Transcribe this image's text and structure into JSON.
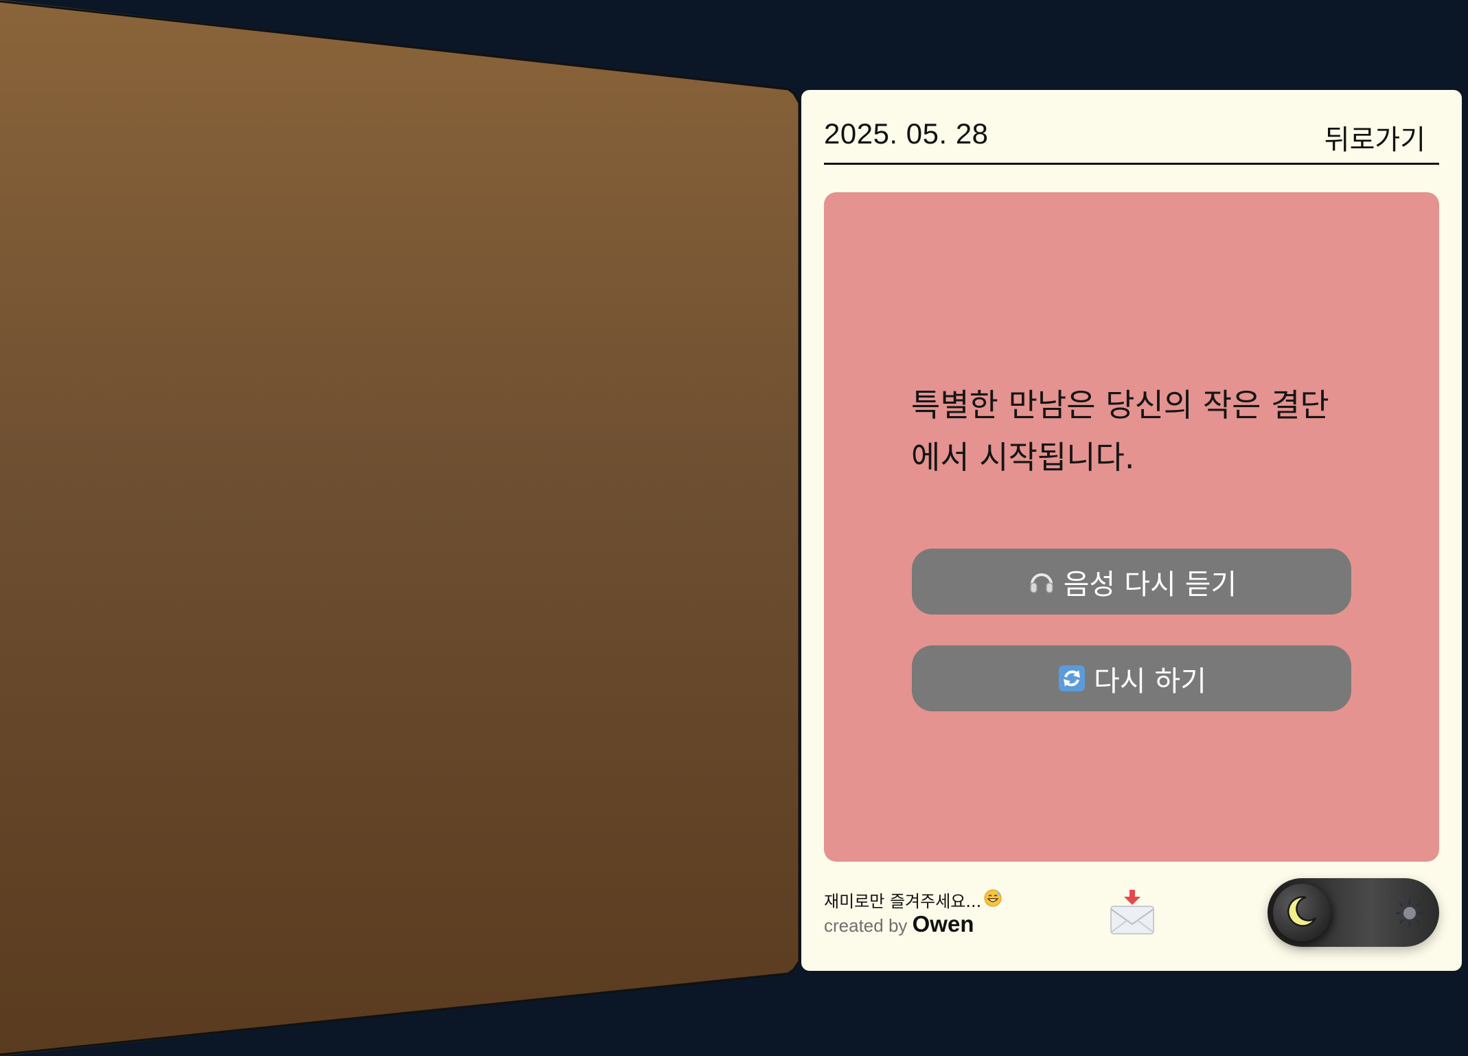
{
  "header": {
    "date": "2025. 05. 28",
    "back_label": "뒤로가기"
  },
  "card": {
    "background_color": "#e49390",
    "message": "특별한 만남은 당신의 작은 결단에서 시작됩니다.",
    "listen_again_label": "음성 다시 듣기",
    "listen_again_icon": "headphones-icon",
    "retry_label": "다시 하기",
    "retry_icon": "refresh-icon"
  },
  "footer": {
    "note": "재미로만 즐겨주세요...",
    "note_icon": "grinning-sweat-emoji",
    "credit_prefix": "created by",
    "credit_name": "Owen",
    "mail_icon": "envelope-download-icon",
    "theme_toggle": {
      "mode": "dark",
      "left_icon": "moon-icon",
      "right_icon": "sun-icon"
    }
  },
  "colors": {
    "background": "#0b1726",
    "page": "#fdfbe9",
    "button": "#797979",
    "cover": "#7a5533"
  }
}
